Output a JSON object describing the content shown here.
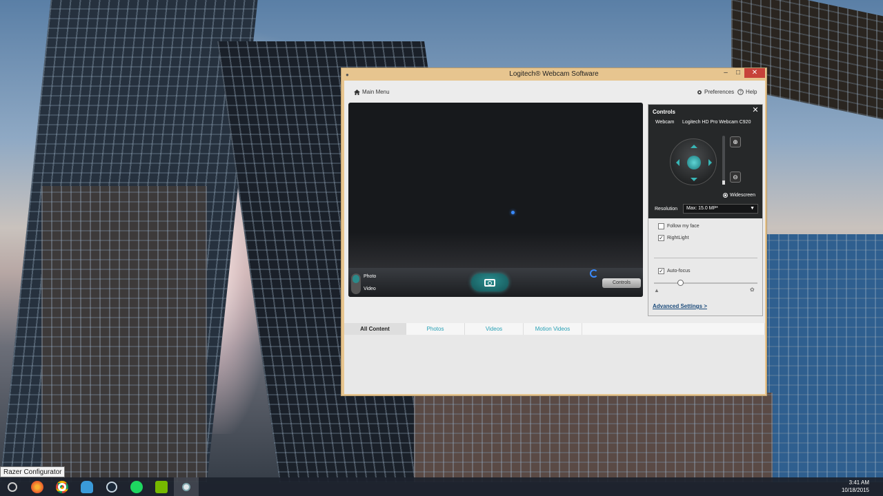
{
  "window": {
    "title": "Logitech® Webcam Software",
    "min_label": "–",
    "max_label": "□",
    "close_label": "✕"
  },
  "topbar": {
    "main_menu": "Main Menu",
    "preferences": "Preferences",
    "help": "Help"
  },
  "preview": {
    "mode_photo": "Photo",
    "mode_video": "Video",
    "controls_button": "Controls"
  },
  "controls": {
    "title": "Controls",
    "close_label": "✕",
    "webcam_label": "Webcam",
    "webcam_value": "Logitech HD Pro Webcam C920",
    "zoom_in_label": "⊕",
    "zoom_out_label": "⊖",
    "widescreen": "Widescreen",
    "resolution_label": "Resolution",
    "resolution_value": "Max: 15.0 MP*",
    "follow_my_face": "Follow my face",
    "rightlight": "RightLight",
    "rightlight_check": "✓",
    "autofocus": "Auto-focus",
    "autofocus_check": "✓",
    "advanced_settings": "Advanced Settings >"
  },
  "tabs": {
    "all_content": "All Content",
    "photos": "Photos",
    "videos": "Videos",
    "motion_videos": "Motion Videos"
  },
  "taskbar": {
    "tooltip": "Razer Configurator",
    "time": "3:41 AM",
    "date": "10/18/2015"
  },
  "colors": {
    "accent": "#27a0b5",
    "window_frame": "#e7c58f",
    "close_red": "#c7423a"
  }
}
